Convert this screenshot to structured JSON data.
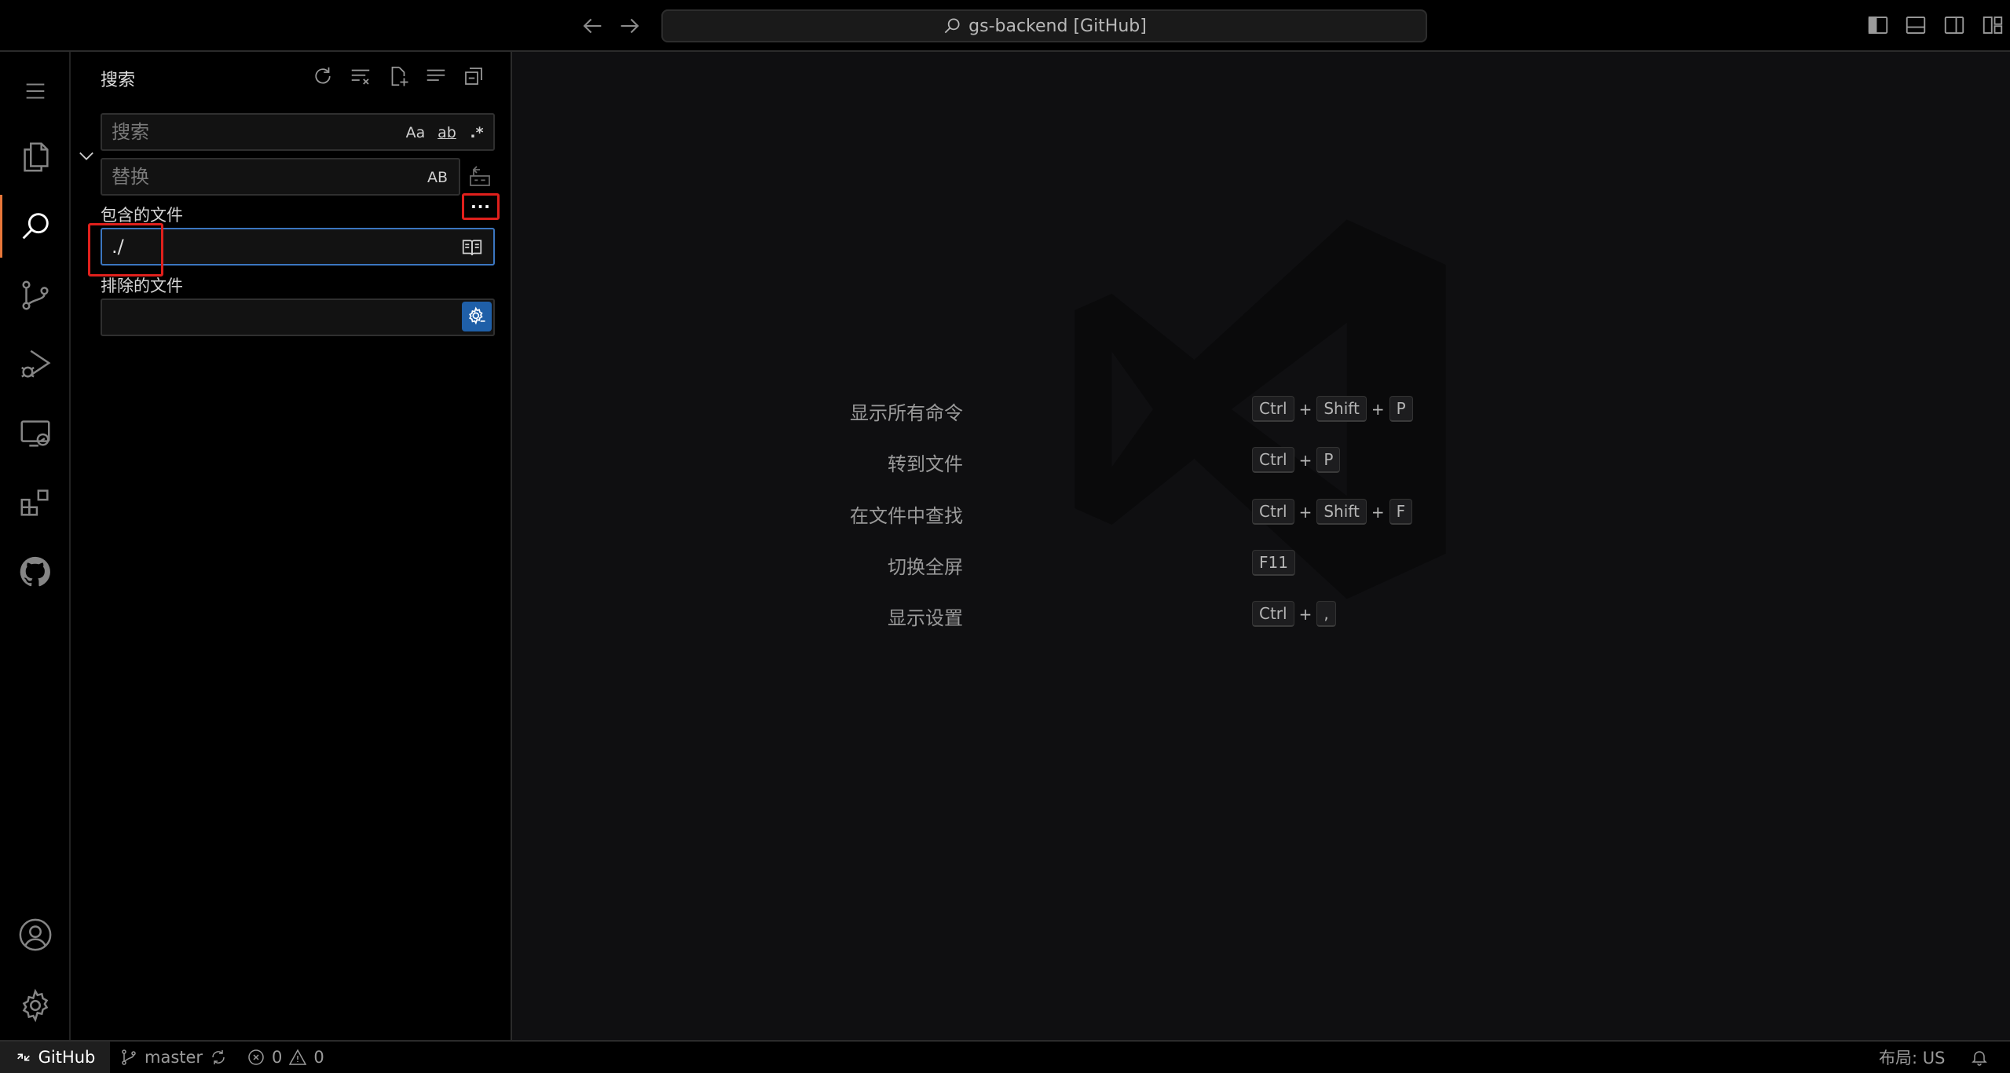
{
  "titlebar": {
    "command_center": "gs-backend [GitHub]"
  },
  "activitybar": {
    "items": [
      "menu",
      "explorer",
      "search",
      "source-control",
      "run-and-debug",
      "remote-explorer",
      "extensions",
      "github",
      "accounts",
      "manage"
    ],
    "active": "search"
  },
  "sidebar": {
    "title": "搜索",
    "search": {
      "placeholder": "搜索",
      "value": "",
      "opt_case": "Aa",
      "opt_word": "ab",
      "opt_regex": ".*"
    },
    "replace": {
      "placeholder": "替换",
      "value": "",
      "opt_preserve_case": "AB"
    },
    "more_options": "···",
    "include": {
      "label": "包含的文件",
      "value": "./"
    },
    "exclude": {
      "label": "排除的文件",
      "value": ""
    }
  },
  "editor": {
    "shortcuts": [
      {
        "label": "显示所有命令",
        "keys": [
          "Ctrl",
          "Shift",
          "P"
        ]
      },
      {
        "label": "转到文件",
        "keys": [
          "Ctrl",
          "P"
        ]
      },
      {
        "label": "在文件中查找",
        "keys": [
          "Ctrl",
          "Shift",
          "F"
        ]
      },
      {
        "label": "切换全屏",
        "keys": [
          "F11"
        ]
      },
      {
        "label": "显示设置",
        "keys": [
          "Ctrl",
          ","
        ]
      }
    ]
  },
  "statusbar": {
    "remote": "GitHub",
    "branch": "master",
    "errors": "0",
    "warnings": "0",
    "layout": "布局: US"
  },
  "colors": {
    "accent_active": "#e8773a",
    "focus_border": "#3b76c0",
    "highlight_box": "#e0201c"
  }
}
